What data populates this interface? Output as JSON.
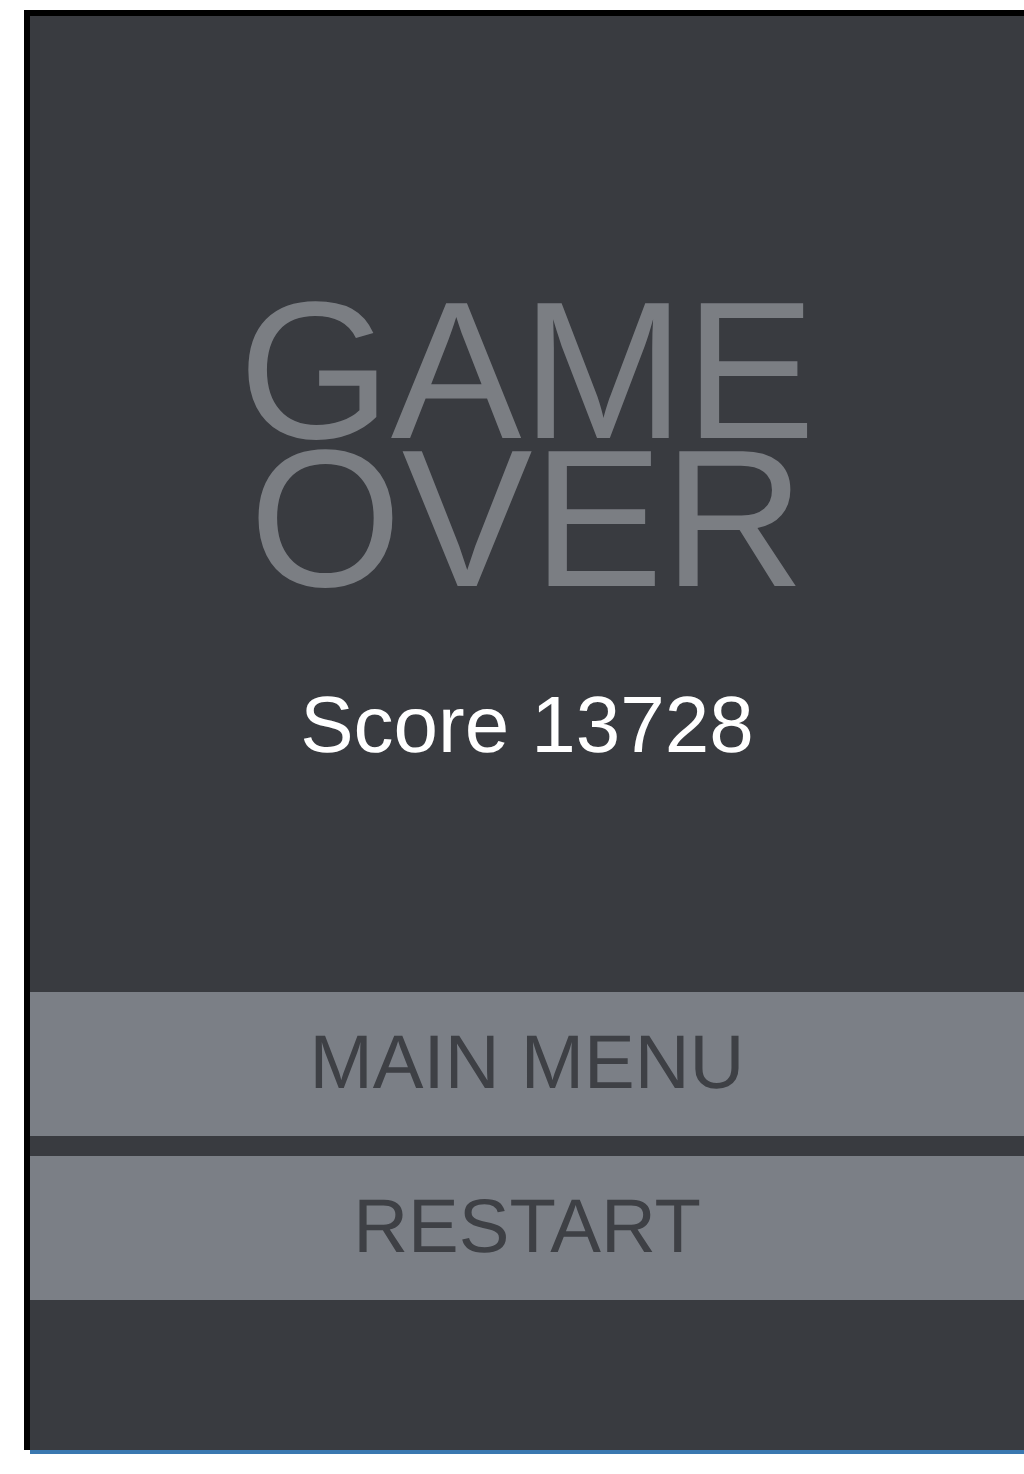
{
  "title": "GAME OVER",
  "score": "Score 13728",
  "buttons": [
    {
      "label": "MAIN MENU"
    },
    {
      "label": "RESTART"
    }
  ]
}
